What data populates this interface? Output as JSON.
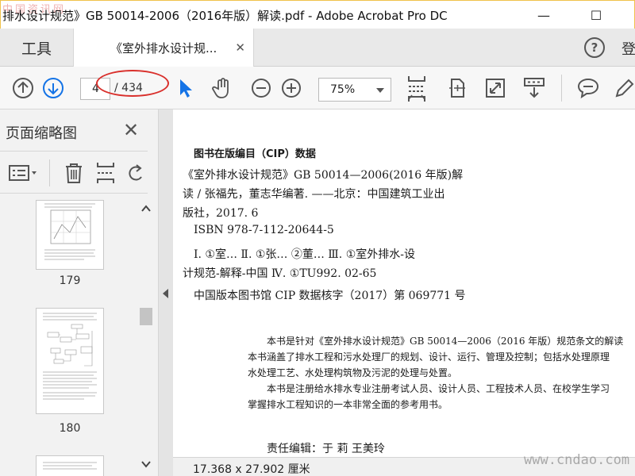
{
  "window": {
    "title": "排水设计规范》GB 50014-2006（2016年版）解读.pdf - Adobe Acrobat Pro DC",
    "watermark_top": "中国资讯网",
    "minimize_glyph": "—",
    "maximize_glyph": "☐"
  },
  "tabs": {
    "tools_label": "工具",
    "doc_label": "《室外排水设计规...",
    "close_glyph": "✕",
    "help_glyph": "?",
    "login_label": "登"
  },
  "toolbar": {
    "page_current": "4",
    "page_total": "/ 434",
    "zoom": "75%",
    "icons": [
      "prev-page-icon",
      "next-page-icon",
      "select-arrow-icon",
      "hand-icon",
      "zoom-out-icon",
      "zoom-in-icon",
      "scroll-mode-icon",
      "fit-page-icon",
      "fullscreen-icon",
      "read-mode-icon",
      "comment-icon",
      "edit-pen-icon"
    ]
  },
  "sidebar": {
    "title": "页面缩略图",
    "close_glyph": "✕",
    "thumbnails": [
      {
        "label": "179"
      },
      {
        "label": "180"
      }
    ]
  },
  "document": {
    "cip_heading": "图书在版编目（CIP）数据",
    "cip_lines": [
      "《室外排水设计规范》GB 50014—2006(2016 年版)解",
      "读 / 张福先，董志华编著. ——北京：中国建筑工业出",
      "版社，2017. 6",
      "ISBN 978-7-112-20644-5",
      "Ⅰ. ①室…  Ⅱ. ①张…  ②董…  Ⅲ. ①室外排水-设",
      "计规范-解释-中国  Ⅳ. ①TU992. 02-65",
      "中国版本图书馆 CIP 数据核字（2017）第 069771 号"
    ],
    "intro_lines": [
      "本书是针对《室外排水设计规范》GB 50014—2006（2016 年版）规范条文的解读",
      "本书涵盖了排水工程和污水处理厂的规划、设计、运行、管理及控制；包括水处理原理",
      "水处理工艺、水处理构筑物及污泥的处理与处置。",
      "本书是注册给水排水专业注册考试人员、设计人员、工程技术人员、在校学生学习",
      "掌握排水工程知识的一本非常全面的参考用书。"
    ],
    "editor_line": "责任编辑：于   莉   王美玲"
  },
  "status": {
    "page_size": "17.368 x 27.902 厘米"
  },
  "watermark_bottom": "www.cndao.com",
  "colors": {
    "accent_blue": "#1473e6",
    "annotation_red": "#d9302c",
    "icon_gray": "#555555"
  }
}
